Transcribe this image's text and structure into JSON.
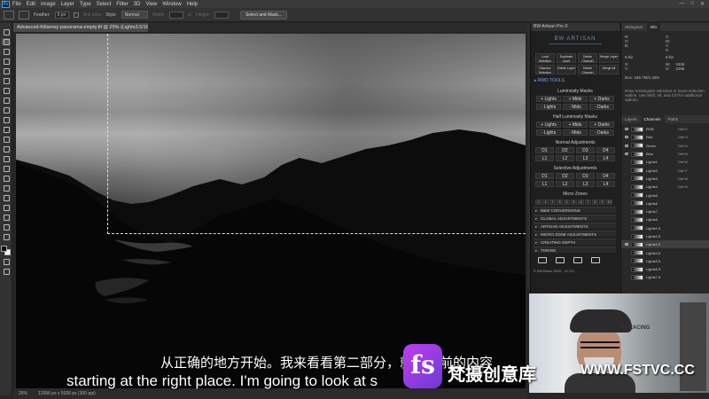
{
  "app": {
    "logo_text": "Ps"
  },
  "menu": [
    "File",
    "Edit",
    "Image",
    "Layer",
    "Type",
    "Select",
    "Filter",
    "3D",
    "View",
    "Window",
    "Help"
  ],
  "window_controls": [
    "—",
    "□",
    "✕"
  ],
  "options_bar": {
    "feather_label": "Feather:",
    "feather_value": "0 px",
    "anti_alias_label": "Anti-alias",
    "style_label": "Style:",
    "style_value": "Normal",
    "width_label": "Width:",
    "height_label": "Height:",
    "select_mask_label": "Select and Mask..."
  },
  "document": {
    "tab_title": "Advanced-Killarney panorama-empty.tif @ 25% (Lights3.5/16) *",
    "zoom": "25%",
    "doc_size": "12656 px x 5936 px (300 ppi)"
  },
  "plugin": {
    "title": "BW Artisan Pro X",
    "logo": "BW ARTISAN",
    "quick_buttons": [
      "Load Selection",
      "Duplicate Layer",
      "Delete Channel",
      "Merge Layer",
      "Dissolve Selection",
      "Delete Layer",
      "Delete Channel",
      "Merge All"
    ],
    "rwd_tools": "▸ RWD TOOLS",
    "lum_masks_title": "Luminosity Masks",
    "lum_masks": [
      "+ Lights",
      "+ Mids",
      "+ Darks",
      "- Lights",
      "- Mids",
      "- Darks"
    ],
    "half_lum_title": "Half Luminosity Masks",
    "half_lum_masks": [
      "+ Lights",
      "+ Mids",
      "+ Darks",
      "- Lights",
      "- Mids",
      "- Darks"
    ],
    "normal_adj_title": "Normal Adjustments",
    "normal_adj": [
      "D1",
      "D2",
      "D3",
      "D4",
      "L1",
      "L2",
      "L3",
      "L4"
    ],
    "selective_adj_title": "Selective Adjustments",
    "selective_adj": [
      "D1",
      "D2",
      "D3",
      "D4",
      "L1",
      "L2",
      "L3",
      "L4"
    ],
    "micro_zones_title": "Micro Zones",
    "micro_zones": [
      "0",
      "1",
      "2",
      "3",
      "4",
      "5",
      "6",
      "7",
      "8",
      "9",
      "10"
    ],
    "sections": [
      "B&W CONVERSIONS",
      "GLOBAL ADJUSTMENTS",
      "ARTISAN ADJUSTMENTS",
      "MICRO ZONE ADJUSTMENTS",
      "CREATING DEPTH",
      "TONING"
    ],
    "footer": "© BWVision 2020 - v1.3.0"
  },
  "right_panel": {
    "top_tabs": [
      "Histogram",
      "Info"
    ],
    "info": {
      "rgb": "R:\nG:\nB:",
      "cmyk": "C:\nM:\nY:\nK:",
      "bit_left": "8-bit",
      "bit_right": "8-bit",
      "xy": "X:\nY:",
      "wh": "W:\nH:",
      "wh_values": "3456\n2296",
      "doc_info": "Doc: 445.7M/1.33G",
      "help": "Draw rectangular selection or move selection outline. Use Shift, Alt, and Ctrl for additional options."
    },
    "layer_tabs": [
      "Layers",
      "Channels",
      "Paths"
    ],
    "channels": [
      {
        "name": "RGB",
        "shortcut": "Ctrl+2",
        "visible": true,
        "selected": false
      },
      {
        "name": "Red",
        "shortcut": "Ctrl+3",
        "visible": true,
        "selected": false
      },
      {
        "name": "Green",
        "shortcut": "Ctrl+4",
        "visible": true,
        "selected": false
      },
      {
        "name": "Blue",
        "shortcut": "Ctrl+5",
        "visible": true,
        "selected": false
      },
      {
        "name": "Lights1",
        "shortcut": "Ctrl+6",
        "visible": false,
        "selected": false
      },
      {
        "name": "Lights2",
        "shortcut": "Ctrl+7",
        "visible": false,
        "selected": false
      },
      {
        "name": "Lights3",
        "shortcut": "Ctrl+8",
        "visible": false,
        "selected": false
      },
      {
        "name": "Lights4",
        "shortcut": "Ctrl+9",
        "visible": false,
        "selected": false
      },
      {
        "name": "Lights5",
        "shortcut": "",
        "visible": false,
        "selected": false
      },
      {
        "name": "Lights6",
        "shortcut": "",
        "visible": false,
        "selected": false
      },
      {
        "name": "Lights7",
        "shortcut": "",
        "visible": false,
        "selected": false
      },
      {
        "name": "Lights8",
        "shortcut": "",
        "visible": false,
        "selected": false
      },
      {
        "name": "Lights1.5",
        "shortcut": "",
        "visible": false,
        "selected": false
      },
      {
        "name": "Lights2.5",
        "shortcut": "",
        "visible": false,
        "selected": false
      },
      {
        "name": "Lights3.5",
        "shortcut": "",
        "visible": true,
        "selected": true
      },
      {
        "name": "Lights4.5",
        "shortcut": "",
        "visible": false,
        "selected": false
      },
      {
        "name": "Lights5.5",
        "shortcut": "",
        "visible": false,
        "selected": false
      },
      {
        "name": "Lights6.5",
        "shortcut": "",
        "visible": false,
        "selected": false
      },
      {
        "name": "Lights7.5",
        "shortcut": "",
        "visible": false,
        "selected": false
      }
    ]
  },
  "webcam": {
    "logo_text": "AKRACING"
  },
  "captions": {
    "chinese": "从正确的地方开始。我来看看第二部分，就是之前的内容",
    "english": "starting at the right place. I'm going to look at s"
  },
  "watermark": {
    "badge": "fs",
    "site_name": "梵摄创意库",
    "url": "WWW.FSTVC.CC"
  }
}
